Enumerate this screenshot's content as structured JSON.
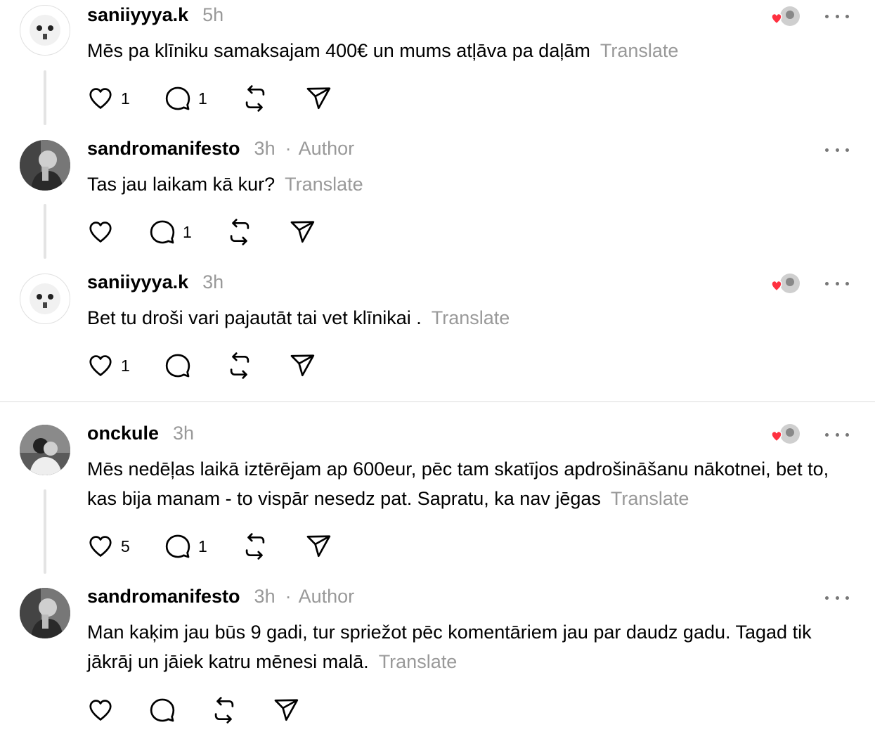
{
  "posts": [
    {
      "username": "saniiyyya.k",
      "time": "5h",
      "text": "Mēs pa klīniku samaksajam 400€ un mums atļāva pa daļām",
      "translate": "Translate",
      "likes": "1",
      "replies": "1"
    },
    {
      "username": "sandromanifesto",
      "time": "3h",
      "author_dot": "·",
      "author": "Author",
      "text": "Tas jau laikam kā kur?",
      "translate": "Translate",
      "replies": "1"
    },
    {
      "username": "saniiyyya.k",
      "time": "3h",
      "text": "Bet tu droši vari pajautāt tai vet klīnikai .",
      "translate": "Translate",
      "likes": "1"
    },
    {
      "username": "onckule",
      "time": "3h",
      "text": "Mēs nedēļas laikā iztērējam ap 600eur, pēc tam skatījos apdrošināšanu nākotnei, bet to, kas bija manam - to vispār nesedz pat. Sapratu, ka nav jēgas",
      "translate": "Translate",
      "likes": "5",
      "replies": "1"
    },
    {
      "username": "sandromanifesto",
      "time": "3h",
      "author_dot": "·",
      "author": "Author",
      "text": "Man kaķim jau būs 9 gadi, tur spriežot pēc komentāriem jau par daudz gadu. Tagad tik jākrāj un jāiek katru mēnesi malā.",
      "translate": "Translate"
    }
  ],
  "colors": {
    "like_heart": "#ff3040",
    "secondary_text": "#999999",
    "thread_line": "#e4e4e4"
  },
  "icons": [
    "heart-icon",
    "comment-icon",
    "repost-icon",
    "share-icon",
    "more-icon",
    "liked-by-author-icon"
  ]
}
